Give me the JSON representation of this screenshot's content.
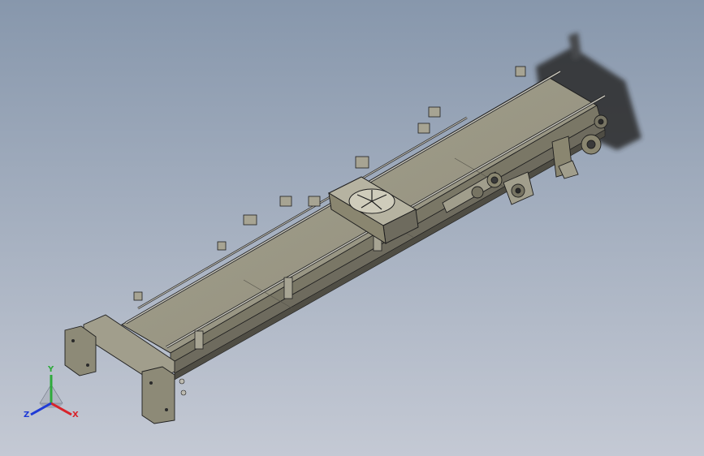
{
  "view": {
    "background_top": "#8797ac",
    "background_bottom": "#c4c9d4"
  },
  "model": {
    "part_color": "#8a8670",
    "frame_color": "#6e6b5e",
    "belt_color": "#9d9a87",
    "edge_color": "#1e1e1e"
  },
  "triad": {
    "x_label": "X",
    "y_label": "Y",
    "z_label": "Z",
    "x_color": "#d8232a",
    "y_color": "#2faa3c",
    "z_color": "#1f3bd6"
  }
}
